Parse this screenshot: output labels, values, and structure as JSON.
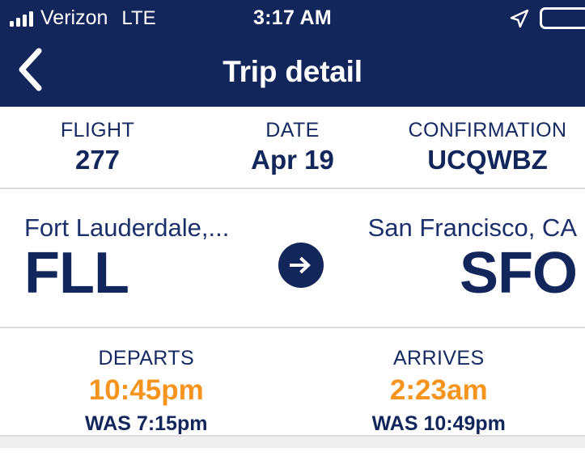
{
  "colors": {
    "navy": "#12265C",
    "navy_text": "#152A63",
    "orange": "#F7941E",
    "divider": "#DCDCDC",
    "white": "#FFFFFF"
  },
  "status_bar": {
    "carrier": "Verizon",
    "network": "LTE",
    "time": "3:17 AM",
    "signal_bars_filled": 4,
    "location_icon": "location-arrow-icon",
    "battery_icon": "battery-icon"
  },
  "nav": {
    "back_icon": "chevron-left-icon",
    "title": "Trip detail"
  },
  "flight_info": [
    {
      "label": "FLIGHT",
      "value": "277"
    },
    {
      "label": "DATE",
      "value": "Apr 19"
    },
    {
      "label": "CONFIRMATION",
      "value": "UCQWBZ"
    }
  ],
  "route": {
    "origin": {
      "city": "Fort Lauderdale,...",
      "code": "FLL"
    },
    "arrow_icon": "arrow-right-circle-icon",
    "destination": {
      "city": "San Francisco, CA",
      "code": "SFO"
    }
  },
  "times": [
    {
      "label": "DEPARTS",
      "new_time": "10:45pm",
      "old_time": "WAS 7:15pm"
    },
    {
      "label": "ARRIVES",
      "new_time": "2:23am",
      "old_time": "WAS 10:49pm"
    }
  ]
}
